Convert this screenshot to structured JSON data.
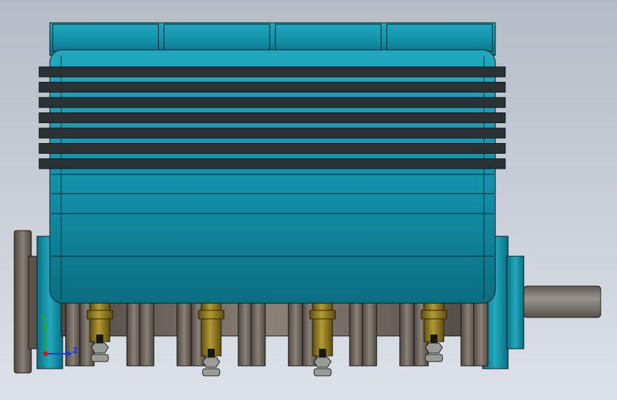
{
  "viewport": {
    "background_top": "#b5bcc7",
    "background_bottom": "#dde1e8"
  },
  "colors": {
    "body_teal": "#1290a8",
    "body_teal_light": "#22a9bf",
    "body_teal_dark": "#0b6e82",
    "cooling_fin": "#2a3236",
    "crankshaft_steel": "#6a6158",
    "connecting_rod_brass": "#8a7320",
    "nut_steel": "#9a9a96",
    "shaft_steel": "#7a7570",
    "edge_line": "#0a1e24"
  },
  "model": {
    "cylinder_count": 4,
    "cooling_fin_count": 7,
    "parts": [
      "cylinder-head",
      "cylinder-block",
      "cooling-fins",
      "crankcase",
      "crankshaft",
      "connecting-rods",
      "flywheel",
      "output-shaft"
    ]
  },
  "triad": {
    "y_label": "Y",
    "z_label": "Z",
    "y_color": "#1cae1c",
    "z_color": "#1f3ad8",
    "x_color": "#d01a1a"
  }
}
